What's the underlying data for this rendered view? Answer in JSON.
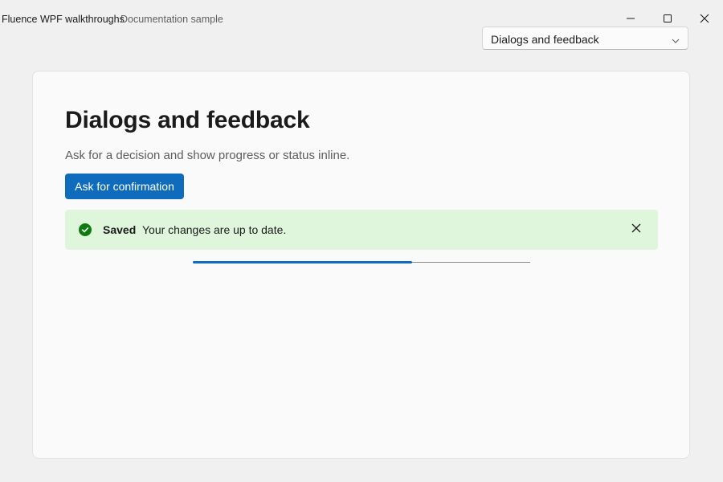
{
  "window": {
    "title": "Fluence WPF walkthroughs",
    "subtitle": "Documentation sample",
    "controls": {
      "minimize_icon": "minimize-icon",
      "maximize_icon": "maximize-icon",
      "close_icon": "close-icon"
    }
  },
  "navigation": {
    "selected": "Dialogs and feedback",
    "chevron_icon": "chevron-down-icon"
  },
  "page": {
    "title": "Dialogs and feedback",
    "description": "Ask for a decision and show progress or status inline.",
    "primary_button": "Ask for confirmation"
  },
  "infobar": {
    "severity": "success",
    "icon": "checkmark-circle-icon",
    "title": "Saved",
    "message": "Your changes are up to date.",
    "close_icon": "dismiss-icon"
  },
  "progress": {
    "value": 0.65
  },
  "colors": {
    "accent": "#0f6cbd",
    "success_background": "#dff6dd",
    "success_icon": "#0f7b0f"
  }
}
